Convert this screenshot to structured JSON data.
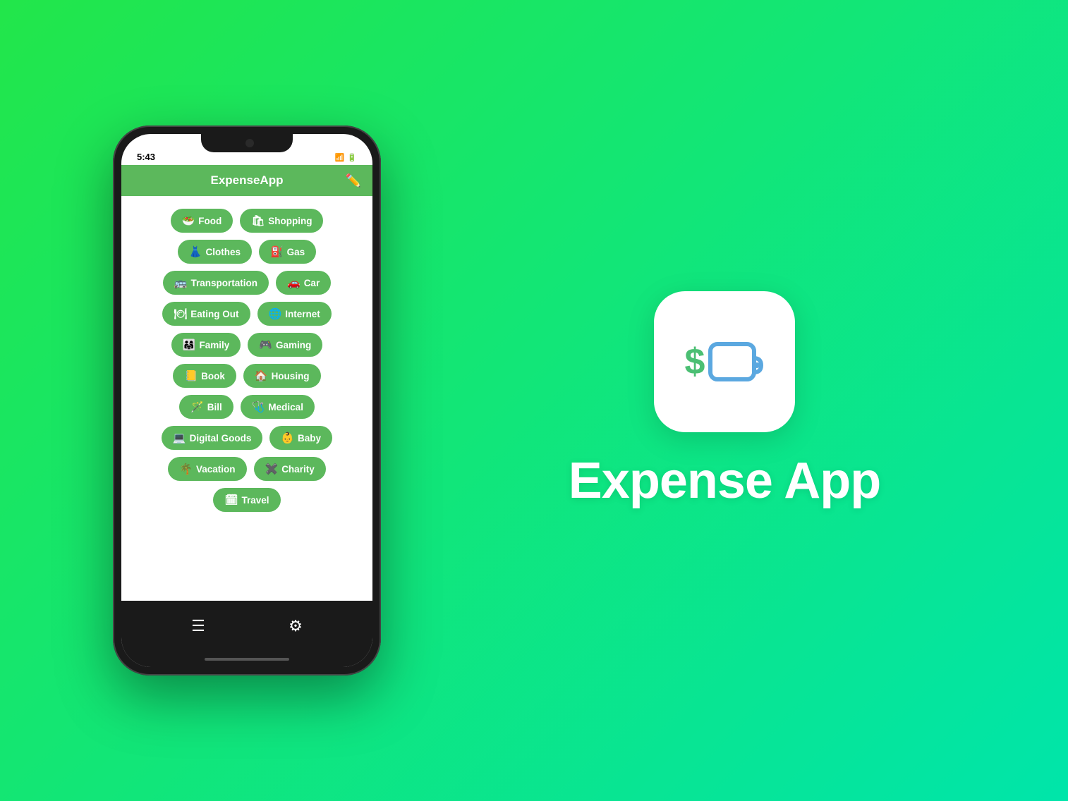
{
  "phone": {
    "status_time": "5:43",
    "nav_title": "ExpenseApp",
    "edit_icon": "✏️",
    "categories": [
      [
        {
          "emoji": "🥗",
          "label": "Food"
        },
        {
          "emoji": "🛍",
          "label": "Shopping"
        }
      ],
      [
        {
          "emoji": "👗",
          "label": "Clothes"
        },
        {
          "emoji": "⛽",
          "label": "Gas"
        }
      ],
      [
        {
          "emoji": "🚌",
          "label": "Transportation"
        },
        {
          "emoji": "🚗",
          "label": "Car"
        }
      ],
      [
        {
          "emoji": "🍽",
          "label": "Eating Out"
        },
        {
          "emoji": "🌐",
          "label": "Internet"
        }
      ],
      [
        {
          "emoji": "👨‍👩‍👧",
          "label": "Family"
        },
        {
          "emoji": "🎮",
          "label": "Gaming"
        }
      ],
      [
        {
          "emoji": "📒",
          "label": "Book"
        },
        {
          "emoji": "🏠",
          "label": "Housing"
        }
      ],
      [
        {
          "emoji": "🪄",
          "label": "Bill"
        },
        {
          "emoji": "🩺",
          "label": "Medical"
        }
      ],
      [
        {
          "emoji": "💻",
          "label": "Digital Goods"
        },
        {
          "emoji": "👶",
          "label": "Baby"
        }
      ],
      [
        {
          "emoji": "🌴",
          "label": "Vacation"
        },
        {
          "emoji": "✖",
          "label": "Charity"
        }
      ],
      [
        {
          "emoji": "🗓",
          "label": "Travel"
        }
      ]
    ],
    "tab_list_icon": "☰",
    "tab_settings_icon": "⚙"
  },
  "branding": {
    "dollar": "$",
    "app_name": "Expense App"
  }
}
